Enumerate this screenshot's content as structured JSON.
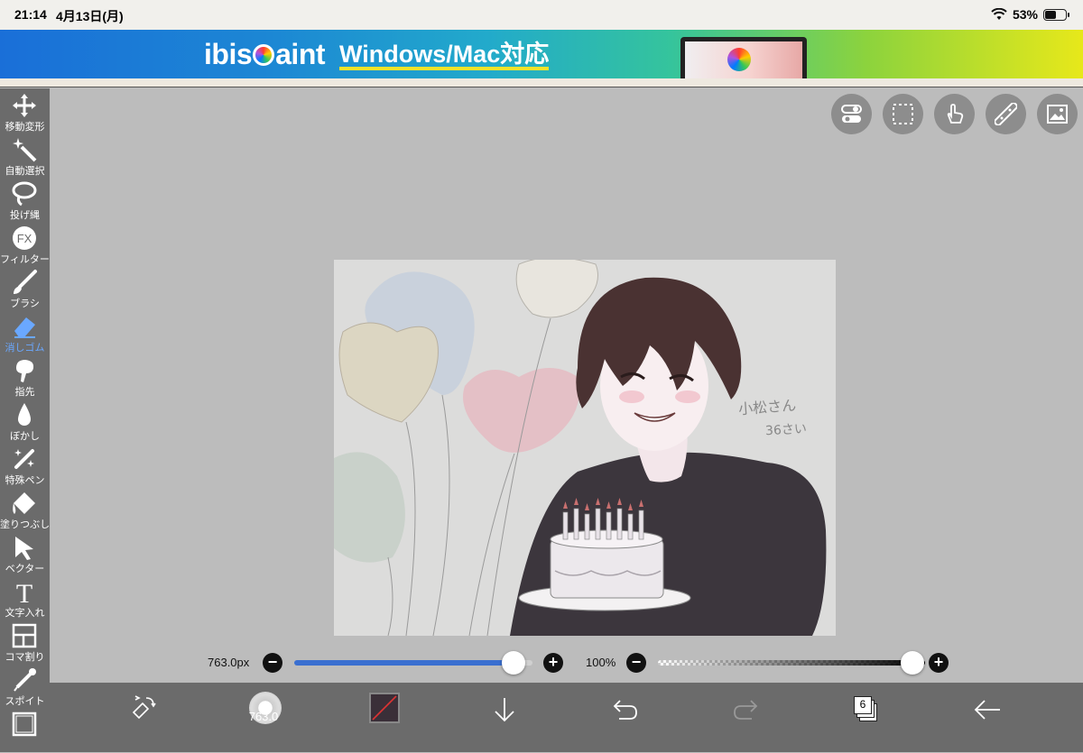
{
  "status_bar": {
    "time": "21:14",
    "date": "4月13日(月)",
    "battery": "53%",
    "battery_level": 0.53,
    "wifi_icon": "wifi-icon"
  },
  "banner": {
    "logo_text_left": "ibis",
    "logo_text_right": "aint",
    "slogan": "Windows/Mac対応"
  },
  "toolbar": {
    "items": [
      {
        "label": "移動変形",
        "icon": "move-transform-icon"
      },
      {
        "label": "自動選択",
        "icon": "magic-wand-icon"
      },
      {
        "label": "投げ縄",
        "icon": "lasso-icon"
      },
      {
        "label": "フィルター",
        "icon": "fx-icon"
      },
      {
        "label": "ブラシ",
        "icon": "brush-icon"
      },
      {
        "label": "消しゴム",
        "icon": "eraser-icon",
        "active": true
      },
      {
        "label": "指先",
        "icon": "smudge-icon"
      },
      {
        "label": "ぼかし",
        "icon": "blur-icon"
      },
      {
        "label": "特殊ペン",
        "icon": "special-pen-icon"
      },
      {
        "label": "塗りつぶし",
        "icon": "fill-bucket-icon"
      },
      {
        "label": "ベクター",
        "icon": "vector-icon"
      },
      {
        "label": "文字入れ",
        "icon": "text-icon"
      },
      {
        "label": "コマ割り",
        "icon": "frame-divider-icon"
      },
      {
        "label": "スポイト",
        "icon": "eyedropper-icon"
      }
    ],
    "fx_glyph": "FX",
    "text_glyph": "T"
  },
  "top_buttons": [
    "toggle-icon",
    "selection-icon",
    "hand-icon",
    "ruler-icon",
    "image-icon"
  ],
  "size_slider": {
    "label": "763.0px",
    "minus": "−",
    "plus": "+",
    "value": 0.91
  },
  "opacity_slider": {
    "label": "100%",
    "minus": "−",
    "plus": "+",
    "value": 1.0
  },
  "bottom_bar": {
    "brush_size": "763.0",
    "layer_count": "6",
    "icons": [
      "swap-tool-icon",
      "brush-preview-icon",
      "color-swatch-icon",
      "down-arrow-icon",
      "undo-icon",
      "redo-icon",
      "layers-icon",
      "back-arrow-icon"
    ]
  },
  "canvas": {
    "handwritten_name": "小松さん",
    "handwritten_age": "36さい",
    "colors": {
      "background": "#dcdcdb",
      "accent_blue": "#3a6fd0",
      "active_tool": "#6aa8ff"
    }
  }
}
